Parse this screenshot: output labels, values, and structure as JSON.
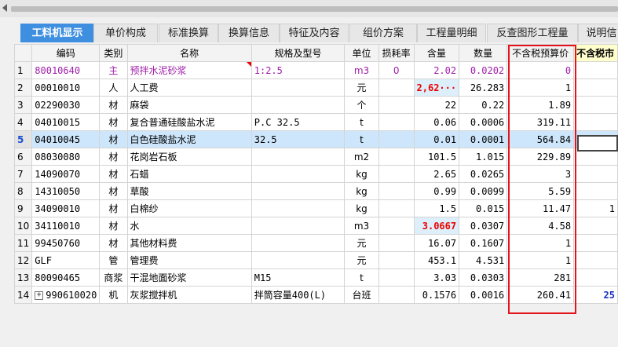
{
  "tabs": [
    {
      "label": "工料机显示",
      "active": true
    },
    {
      "label": "单价构成"
    },
    {
      "label": "标准换算"
    },
    {
      "label": "换算信息"
    },
    {
      "label": "特征及内容"
    },
    {
      "label": "组价方案"
    },
    {
      "label": "工程量明细"
    },
    {
      "label": "反查图形工程量"
    },
    {
      "label": "说明信"
    }
  ],
  "columns": {
    "rownum": "",
    "code": "编码",
    "category": "类别",
    "name": "名称",
    "spec": "规格及型号",
    "unit": "单位",
    "loss": "损耗率",
    "content": "含量",
    "qty": "数量",
    "price": "不含税预算价",
    "market": "不含税市"
  },
  "rows": [
    {
      "n": "1",
      "code": "80010640",
      "cat": "主",
      "name": "预拌水泥砂浆",
      "spec": "1:2.5",
      "unit": "m3",
      "loss": "0",
      "content": "2.02",
      "qty": "0.0202",
      "price": "0",
      "market": "",
      "type": "main"
    },
    {
      "n": "2",
      "code": "00010010",
      "cat": "人",
      "name": "人工费",
      "spec": "",
      "unit": "元",
      "loss": "",
      "content": "2,62···",
      "qty": "26.283",
      "price": "1",
      "market": "",
      "hl": true
    },
    {
      "n": "3",
      "code": "02290030",
      "cat": "材",
      "name": "麻袋",
      "spec": "",
      "unit": "个",
      "loss": "",
      "content": "22",
      "qty": "0.22",
      "price": "1.89",
      "market": ""
    },
    {
      "n": "4",
      "code": "04010015",
      "cat": "材",
      "name": "复合普通硅酸盐水泥",
      "spec": "P.C 32.5",
      "unit": "t",
      "loss": "",
      "content": "0.06",
      "qty": "0.0006",
      "price": "319.11",
      "market": ""
    },
    {
      "n": "5",
      "code": "04010045",
      "cat": "材",
      "name": "白色硅酸盐水泥",
      "spec": "32.5",
      "unit": "t",
      "loss": "",
      "content": "0.01",
      "qty": "0.0001",
      "price": "564.84",
      "market": "",
      "type": "sel"
    },
    {
      "n": "6",
      "code": "08030080",
      "cat": "材",
      "name": "花岗岩石板",
      "spec": "",
      "unit": "m2",
      "loss": "",
      "content": "101.5",
      "qty": "1.015",
      "price": "229.89",
      "market": ""
    },
    {
      "n": "7",
      "code": "14090070",
      "cat": "材",
      "name": "石蜡",
      "spec": "",
      "unit": "kg",
      "loss": "",
      "content": "2.65",
      "qty": "0.0265",
      "price": "3",
      "market": ""
    },
    {
      "n": "8",
      "code": "14310050",
      "cat": "材",
      "name": "草酸",
      "spec": "",
      "unit": "kg",
      "loss": "",
      "content": "0.99",
      "qty": "0.0099",
      "price": "5.59",
      "market": ""
    },
    {
      "n": "9",
      "code": "34090010",
      "cat": "材",
      "name": "白棉纱",
      "spec": "",
      "unit": "kg",
      "loss": "",
      "content": "1.5",
      "qty": "0.015",
      "price": "11.47",
      "market": "1"
    },
    {
      "n": "10",
      "code": "34110010",
      "cat": "材",
      "name": "水",
      "spec": "",
      "unit": "m3",
      "loss": "",
      "content": "3.0667",
      "qty": "0.0307",
      "price": "4.58",
      "market": "",
      "hl": true
    },
    {
      "n": "11",
      "code": "99450760",
      "cat": "材",
      "name": "其他材料费",
      "spec": "",
      "unit": "元",
      "loss": "",
      "content": "16.07",
      "qty": "0.1607",
      "price": "1",
      "market": ""
    },
    {
      "n": "12",
      "code": "GLF",
      "cat": "管",
      "name": "管理费",
      "spec": "",
      "unit": "元",
      "loss": "",
      "content": "453.1",
      "qty": "4.531",
      "price": "1",
      "market": ""
    },
    {
      "n": "13",
      "code": "80090465",
      "cat": "商浆",
      "name": "干混地面砂浆",
      "spec": "M15",
      "unit": "t",
      "loss": "",
      "content": "3.03",
      "qty": "0.0303",
      "price": "281",
      "market": ""
    },
    {
      "n": "14",
      "code": "990610020",
      "cat": "机",
      "name": "灰浆搅拌机",
      "spec": "拌筒容量400(L)",
      "unit": "台班",
      "loss": "",
      "content": "0.1576",
      "qty": "0.0016",
      "price": "260.41",
      "market": "25",
      "expand": "+",
      "marketBlue": true
    }
  ]
}
